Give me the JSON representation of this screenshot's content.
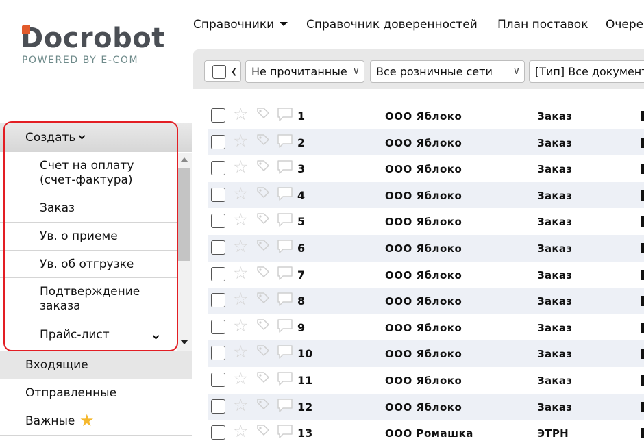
{
  "logo": {
    "name": "Docrobot",
    "tagline": "POWERED BY E-COM"
  },
  "topnav": {
    "items": [
      {
        "label": "Справочники",
        "has_dropdown": true
      },
      {
        "label": "Справочник доверенностей"
      },
      {
        "label": "План поставок"
      },
      {
        "label": "Очере"
      }
    ]
  },
  "filters": {
    "read_status": "Не прочитанные",
    "retail_networks": "Все розничные сети",
    "doc_type": "[Тип] Все документ"
  },
  "sidebar": {
    "create_label": "Создать",
    "create_items": [
      {
        "label": "Счет на оплату\n(счет-фактура)"
      },
      {
        "label": "Заказ"
      },
      {
        "label": "Ув. о приеме"
      },
      {
        "label": "Ув. об отгрузке"
      },
      {
        "label": "Подтверждение\nзаказа"
      },
      {
        "label": "Прайс-лист"
      }
    ],
    "inbox": "Входящие",
    "sent": "Отправленные",
    "favorites": "Важные"
  },
  "colors": {
    "highlight": "#e31e24",
    "row_alt": "#edf0f6",
    "logo_accent": "#e25a2b",
    "favorite_star": "#f5b82e"
  },
  "documents": [
    {
      "number": "1",
      "company": "ООО Яблоко",
      "type": "Заказ"
    },
    {
      "number": "2",
      "company": "ООО Яблоко",
      "type": "Заказ"
    },
    {
      "number": "3",
      "company": "ООО Яблоко",
      "type": "Заказ"
    },
    {
      "number": "4",
      "company": "ООО Яблоко",
      "type": "Заказ"
    },
    {
      "number": "5",
      "company": "ООО Яблоко",
      "type": "Заказ"
    },
    {
      "number": "6",
      "company": "ООО Яблоко",
      "type": "Заказ"
    },
    {
      "number": "7",
      "company": "ООО Яблоко",
      "type": "Заказ"
    },
    {
      "number": "8",
      "company": "ООО Яблоко",
      "type": "Заказ"
    },
    {
      "number": "9",
      "company": "ООО Яблоко",
      "type": "Заказ"
    },
    {
      "number": "10",
      "company": "ООО Яблоко",
      "type": "Заказ"
    },
    {
      "number": "11",
      "company": "ООО Яблоко",
      "type": "Заказ"
    },
    {
      "number": "12",
      "company": "ООО Яблоко",
      "type": "Заказ"
    },
    {
      "number": "13",
      "company": "ООО Ромашка",
      "type": "ЭТРН"
    }
  ]
}
